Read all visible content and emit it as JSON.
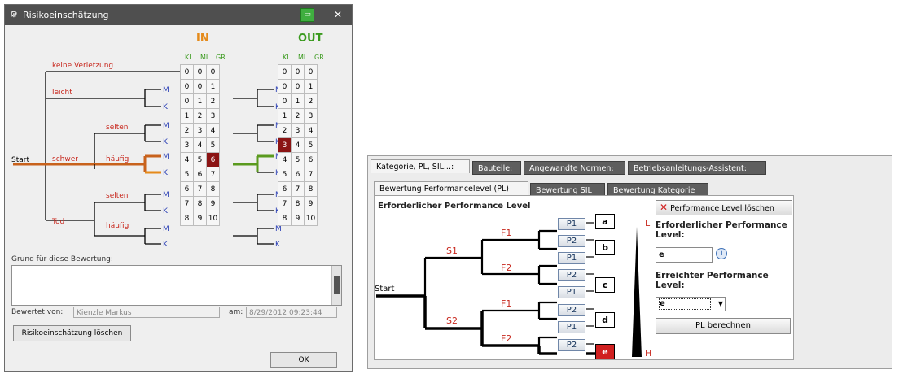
{
  "dialog": {
    "title": "Risikoeinschätzung",
    "in_header": "IN",
    "out_header": "OUT",
    "col_headers": [
      "KL",
      "MI",
      "GR"
    ],
    "start_label": "Start",
    "branches": {
      "keine": "keine Verletzung",
      "leicht": "leicht",
      "schwer": "schwer",
      "tod": "Tod",
      "selten": "selten",
      "haeufig": "häufig"
    },
    "mk": {
      "m": "M",
      "k": "K"
    },
    "in_rows": [
      [
        "0",
        "0",
        "0"
      ],
      [
        "0",
        "0",
        "1"
      ],
      [
        "0",
        "1",
        "2"
      ],
      [
        "1",
        "2",
        "3"
      ],
      [
        "2",
        "3",
        "4"
      ],
      [
        "3",
        "4",
        "5"
      ],
      [
        "4",
        "5",
        "6"
      ],
      [
        "5",
        "6",
        "7"
      ],
      [
        "6",
        "7",
        "8"
      ],
      [
        "7",
        "8",
        "9"
      ],
      [
        "8",
        "9",
        "10"
      ]
    ],
    "out_rows": [
      [
        "0",
        "0",
        "0"
      ],
      [
        "0",
        "0",
        "1"
      ],
      [
        "0",
        "1",
        "2"
      ],
      [
        "1",
        "2",
        "3"
      ],
      [
        "2",
        "3",
        "4"
      ],
      [
        "3",
        "4",
        "5"
      ],
      [
        "4",
        "5",
        "6"
      ],
      [
        "5",
        "6",
        "7"
      ],
      [
        "6",
        "7",
        "8"
      ],
      [
        "7",
        "8",
        "9"
      ],
      [
        "8",
        "9",
        "10"
      ]
    ],
    "in_selected": {
      "row": 6,
      "col": 2
    },
    "out_selected": {
      "row": 5,
      "col": 0
    },
    "reason_label": "Grund für diese Bewertung:",
    "reason_value": "",
    "rated_by_label": "Bewertet von:",
    "rated_by_value": "Kienzle Markus",
    "date_label": "am:",
    "date_value": "8/29/2012 09:23:44",
    "delete_button": "Risikoeinschätzung löschen",
    "ok_button": "OK",
    "colors": {
      "in": "#e58a1a",
      "out": "#3a9a1e",
      "selected": "#8b1414",
      "red_label": "#c8281e"
    }
  },
  "panel": {
    "tabs": [
      "Kategorie, PL, SIL...:",
      "Bauteile:",
      "Angewandte Normen:",
      "Betriebsanleitungs-Assistent:"
    ],
    "subtabs": [
      "Bewertung Performancelevel (PL)",
      "Bewertung SIL",
      "Bewertung Kategorie"
    ],
    "section_title": "Erforderlicher Performance Level",
    "start_label": "Start",
    "s_labels": [
      "S1",
      "S2"
    ],
    "f_labels": [
      "F1",
      "F2",
      "F1",
      "F2"
    ],
    "p_labels": [
      "P1",
      "P2",
      "P1",
      "P2",
      "P1",
      "P2",
      "P1",
      "P2"
    ],
    "levels": [
      "a",
      "b",
      "c",
      "d",
      "e"
    ],
    "selected_level": "e",
    "scale_low": "L",
    "scale_high": "H",
    "delete_button": "Performance Level löschen",
    "required_label": "Erforderlicher Performance Level:",
    "required_value": "e",
    "achieved_label": "Erreichter Performance Level:",
    "achieved_value": "e",
    "calc_button": "PL berechnen"
  }
}
